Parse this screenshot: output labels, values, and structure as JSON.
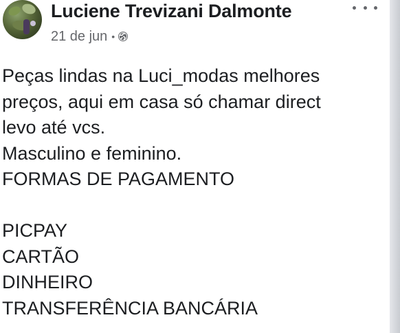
{
  "post": {
    "author_name": "Luciene Trevizani Dalmonte",
    "date": "21 de jun",
    "separator": "•",
    "privacy_icon": "globe-icon",
    "more_icon": "more-options-icon",
    "body": "Peças lindas na Luci_modas melhores\npreços, aqui em casa só chamar direct\nlevo até vcs.\nMasculino e feminino.\nFORMAS DE PAGAMENTO\n\nPICPAY\nCARTÃO\nDINHEIRO\nTRANSFERÊNCIA BANCÁRIA"
  },
  "colors": {
    "text_primary": "#1c1e21",
    "text_secondary": "#65676b",
    "background": "#ffffff"
  }
}
